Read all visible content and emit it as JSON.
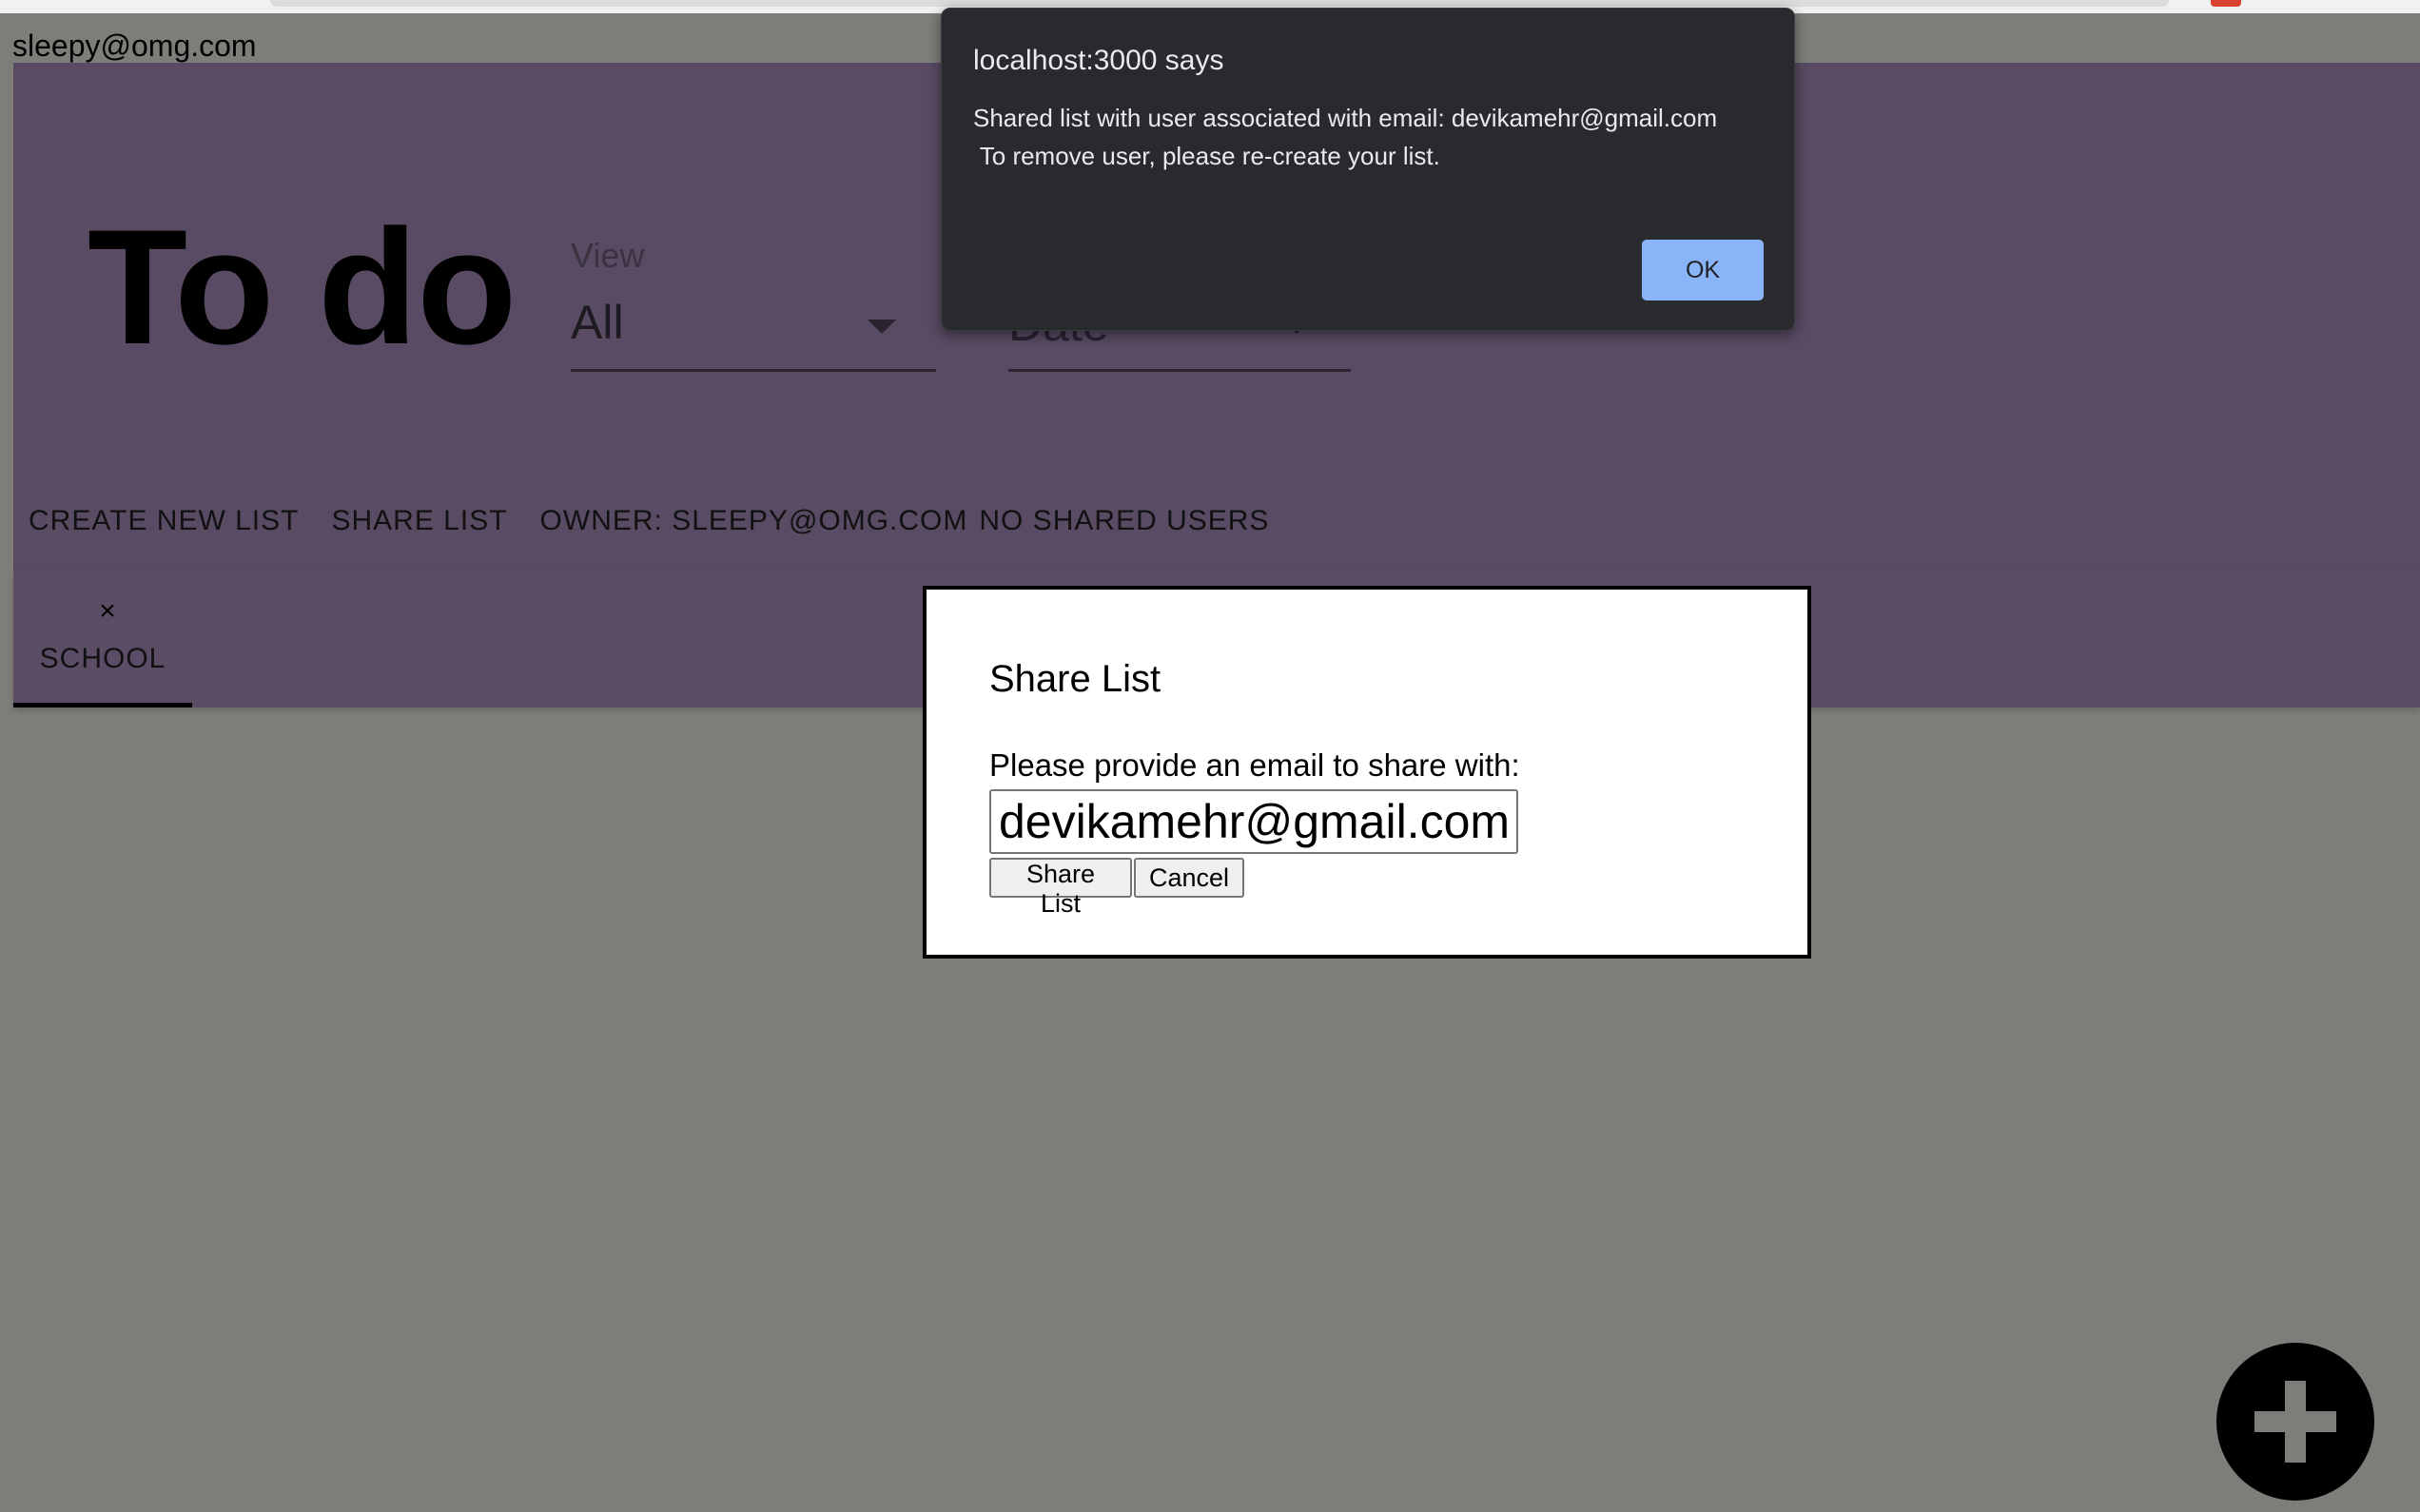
{
  "user": {
    "email": "sleepy@omg.com"
  },
  "header": {
    "title": "To do",
    "view_filter": {
      "label": "View",
      "value": "All"
    },
    "sort_filter": {
      "value": "Date"
    }
  },
  "toolbar": {
    "create_new_list": "CREATE NEW LIST",
    "share_list": "SHARE LIST",
    "owner": "OWNER: SLEEPY@OMG.COM",
    "shared_users": "NO SHARED USERS"
  },
  "tabs": [
    {
      "label": "SCHOOL",
      "close_glyph": "×"
    }
  ],
  "share_modal": {
    "title": "Share List",
    "prompt": "Please provide an email to share with:",
    "email_value": "devikamehr@gmail.com",
    "share_button": "Share List",
    "cancel_button": "Cancel"
  },
  "alert": {
    "title": "localhost:3000 says",
    "line1": "Shared list with user associated with email: devikamehr@gmail.com",
    "line2": " To remove user, please re-create your list.",
    "ok_button": "OK"
  },
  "fab": {
    "icon": "plus-icon"
  },
  "colors": {
    "header_purple_dimmed": "#584b63",
    "overlay_gray": "#7d7d79",
    "alert_bg": "#292a2d",
    "alert_ok": "#8ab4f8"
  }
}
